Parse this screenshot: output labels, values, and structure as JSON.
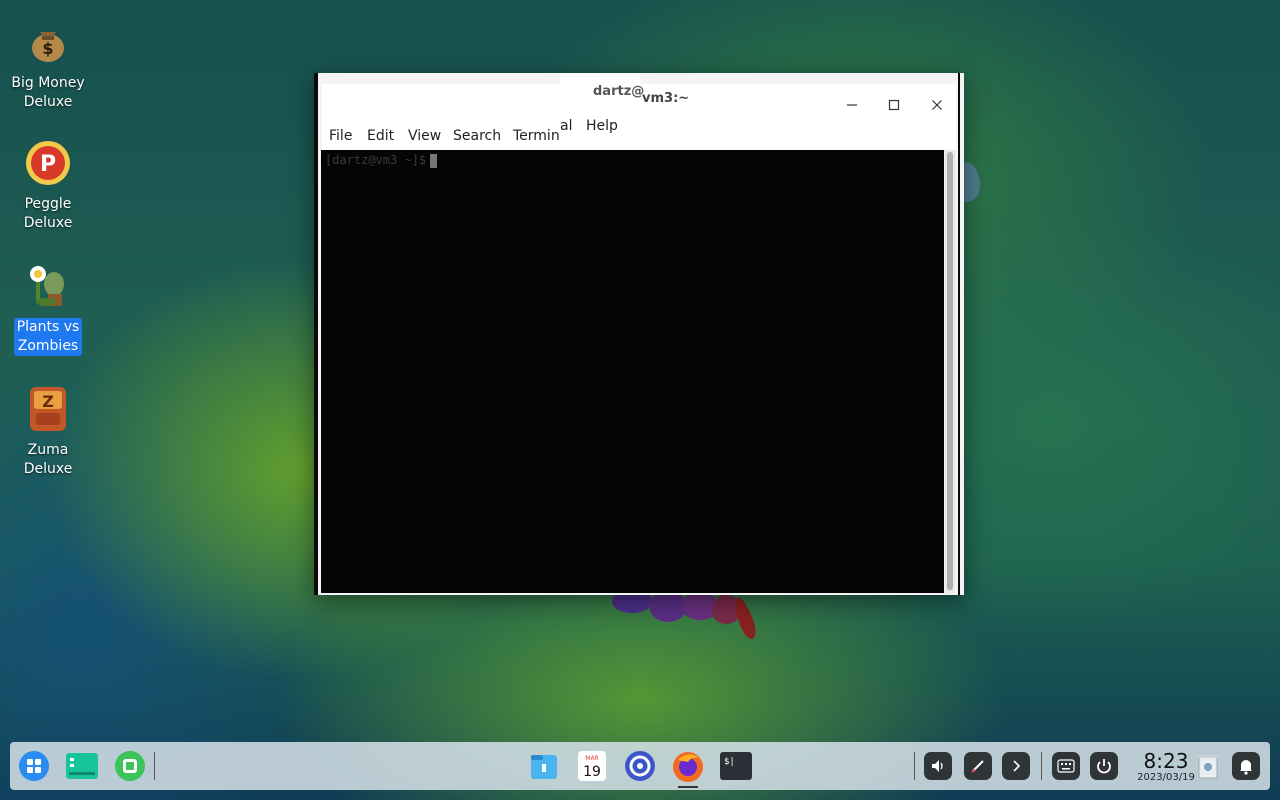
{
  "desktop": {
    "icons": [
      {
        "label": "Big Money\nDeluxe",
        "line1": "Big Money",
        "line2": "Deluxe",
        "icon": "money-bag-icon"
      },
      {
        "label": "Peggle Deluxe",
        "line1": "Peggle",
        "line2": "Deluxe",
        "icon": "peggle-icon"
      },
      {
        "label": "Plants vs Zombies",
        "line1": "Plants vs",
        "line2": "Zombies",
        "icon": "plants-vs-zombies-icon",
        "selected": true
      },
      {
        "label": "Zuma Deluxe",
        "line1": "Zuma",
        "line2": "Deluxe",
        "icon": "zuma-icon"
      }
    ]
  },
  "terminal": {
    "title": "vm3:~",
    "title_overlay": "dartz@",
    "menu": [
      "File",
      "Edit",
      "View",
      "Search",
      "Termin"
    ],
    "menu_overlay_left": "al",
    "menu_overlay_help": "Help",
    "prompt": "[dartz@vm3 ~]$",
    "buttons": {
      "minimize": "—",
      "maximize": "☐",
      "close": "✕"
    }
  },
  "dock": {
    "apps": [
      "launcher-icon",
      "file-manager-panel-icon",
      "app-store-icon",
      "files-icon",
      "calendar-icon",
      "settings-icon",
      "firefox-icon",
      "terminal-icon"
    ],
    "calendar_day": "19",
    "calendar_month": "MAR",
    "terminal_glyph": "$|",
    "tray": [
      "volume-icon",
      "pen-icon",
      "chevron-right-icon",
      "keyboard-icon",
      "power-icon"
    ],
    "clock": {
      "time": "8:23",
      "date": "2023/03/19"
    },
    "extra": [
      "trash-icon",
      "notification-bell-icon"
    ]
  },
  "colors": {
    "selection": "#1e78f0",
    "terminal_bg": "#050505",
    "dock_bg": "#d2dee6"
  }
}
